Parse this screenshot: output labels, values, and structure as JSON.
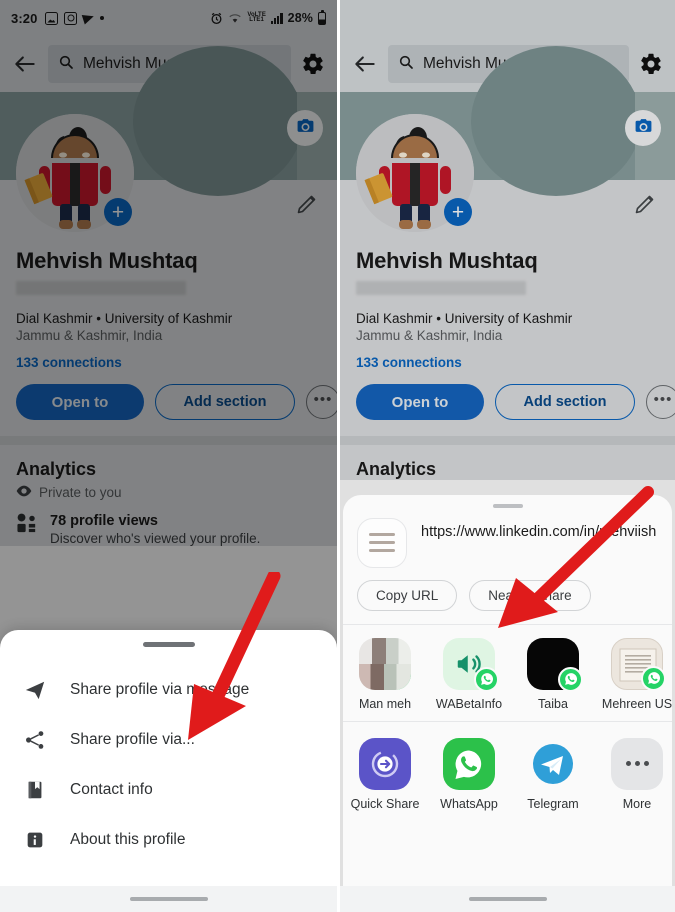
{
  "status_bar": {
    "time": "3:20",
    "left_icons": [
      "photo-icon",
      "instagram-icon",
      "telegram-icon",
      "dot-icon"
    ],
    "volte_label": "VoLTE",
    "battery_percent": "28%",
    "right_icons": [
      "alarm-icon",
      "wifi-icon",
      "volte-icon",
      "signal-icon",
      "battery-icon"
    ]
  },
  "header": {
    "back_icon": "back-arrow-icon",
    "search_icon": "search-icon",
    "search_value": "Mehvish Mushtaq",
    "settings_icon": "gear-icon"
  },
  "cover": {
    "camera_icon": "camera-icon",
    "edit_icon": "pencil-icon",
    "add_badge": "+"
  },
  "profile": {
    "name": "Mehvish Mushtaq",
    "headline": "Dial Kashmir • University of Kashmir",
    "location": "Jammu & Kashmir, India",
    "connections": "133 connections",
    "actions": {
      "open_to": "Open to",
      "add_section": "Add section",
      "more": "•••"
    }
  },
  "analytics": {
    "title": "Analytics",
    "privacy": "Private to you",
    "privacy_icon": "eye-icon",
    "items": [
      {
        "icon": "people-icon",
        "title": "78 profile views",
        "subtitle": "Discover who's viewed your profile."
      }
    ]
  },
  "left_sheet": {
    "grabber": "sheet-grabber",
    "items": [
      {
        "icon": "send-icon",
        "label": "Share profile via message"
      },
      {
        "icon": "share-node-icon",
        "label": "Share profile via..."
      },
      {
        "icon": "contact-card-icon",
        "label": "Contact info"
      },
      {
        "icon": "info-icon",
        "label": "About this profile"
      }
    ]
  },
  "share_sheet": {
    "app_icon": "linkedin-menu-icon",
    "url": "https://www.linkedin.com/in/mehviish",
    "chips": [
      {
        "label": "Copy URL"
      },
      {
        "label": "Nearby Share"
      }
    ],
    "direct_share": [
      {
        "label": "Man meh",
        "badge": "whatsapp-badge",
        "thumb": "photo-thumb"
      },
      {
        "label": "WABetaInfo",
        "badge": "whatsapp-badge",
        "thumb": "megaphone-thumb"
      },
      {
        "label": "Taiba",
        "badge": "whatsapp-badge",
        "thumb": "black-thumb"
      },
      {
        "label": "Mehreen US",
        "badge": "whatsapp-badge",
        "thumb": "note-thumb"
      }
    ],
    "apps": [
      {
        "label": "Quick Share",
        "icon": "quick-share-icon"
      },
      {
        "label": "WhatsApp",
        "icon": "whatsapp-icon"
      },
      {
        "label": "Telegram",
        "icon": "telegram-icon"
      },
      {
        "label": "More",
        "icon": "more-icon"
      }
    ]
  },
  "annotations": {
    "arrows": [
      {
        "name": "arrow-to-share-profile-via"
      },
      {
        "name": "arrow-to-copy-url"
      }
    ],
    "color": "#e01b1b"
  },
  "colors": {
    "linkedin_blue": "#0a66c2",
    "primary_button": "#1565c0",
    "whatsapp_green": "#25d366",
    "telegram_blue": "#2f9fd8",
    "quickshare_purple": "#5b54c8",
    "cover_teal": "#8aa0a0",
    "arrow_red": "#e01b1b"
  }
}
